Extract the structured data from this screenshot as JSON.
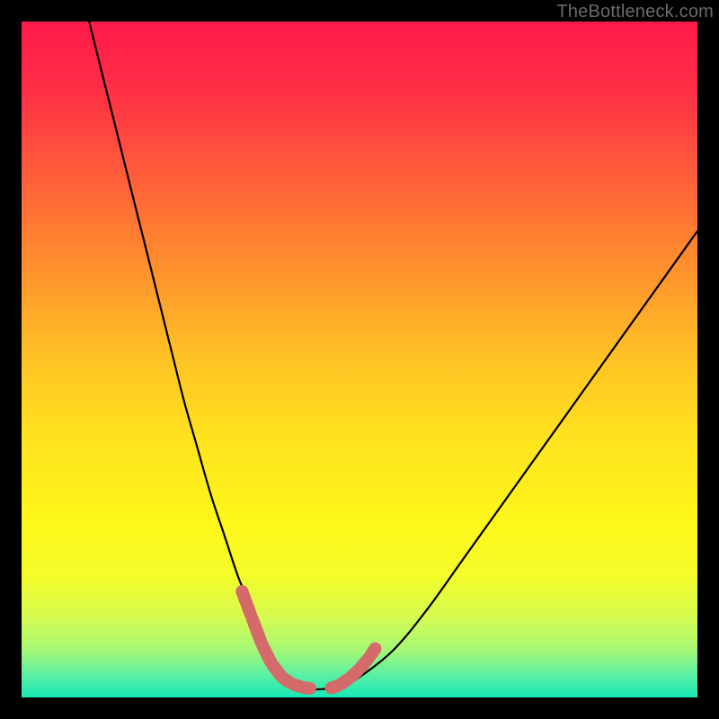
{
  "watermark": {
    "text": "TheBottleneck.com"
  },
  "chart_data": {
    "type": "line",
    "title": "",
    "xlabel": "",
    "ylabel": "",
    "xlim": [
      0,
      100
    ],
    "ylim": [
      0,
      100
    ],
    "grid": false,
    "legend": false,
    "background_gradient": {
      "stops": [
        {
          "t": 0.0,
          "color": "#ff1a4b"
        },
        {
          "t": 0.1,
          "color": "#ff2f46"
        },
        {
          "t": 0.22,
          "color": "#ff5a3a"
        },
        {
          "t": 0.35,
          "color": "#ff8b2e"
        },
        {
          "t": 0.5,
          "color": "#ffc325"
        },
        {
          "t": 0.62,
          "color": "#ffe31e"
        },
        {
          "t": 0.74,
          "color": "#fef71a"
        },
        {
          "t": 0.82,
          "color": "#f4fc2a"
        },
        {
          "t": 0.88,
          "color": "#d6fb4f"
        },
        {
          "t": 0.93,
          "color": "#a6f877"
        },
        {
          "t": 0.965,
          "color": "#5ef0a2"
        },
        {
          "t": 1.0,
          "color": "#17e8b7"
        }
      ]
    },
    "series": [
      {
        "name": "bottleneck-curve",
        "color": "#000000",
        "x": [
          10,
          12,
          14,
          16,
          18,
          20,
          22,
          24,
          26,
          28,
          30,
          32,
          34,
          36,
          37,
          38,
          39,
          40,
          42,
          44,
          46,
          48,
          50,
          55,
          60,
          65,
          70,
          75,
          80,
          85,
          90,
          95,
          100
        ],
        "y": [
          100,
          92,
          84,
          76,
          68,
          60,
          52,
          44,
          37,
          30,
          24,
          18,
          13,
          8,
          5,
          3,
          2,
          1.5,
          1.2,
          1.2,
          1.4,
          2,
          3,
          7,
          13,
          20,
          27,
          34,
          41,
          48,
          55,
          62,
          69
        ]
      }
    ],
    "highlight_segments": [
      {
        "name": "left-dip-marker",
        "color": "#d46a6a",
        "points": [
          {
            "x": 32.5,
            "y": 16
          },
          {
            "x": 34.0,
            "y": 12
          },
          {
            "x": 35.5,
            "y": 8
          },
          {
            "x": 37.0,
            "y": 5
          },
          {
            "x": 38.5,
            "y": 3
          },
          {
            "x": 40.0,
            "y": 2
          },
          {
            "x": 41.5,
            "y": 1.5
          },
          {
            "x": 43.0,
            "y": 1.3
          }
        ]
      },
      {
        "name": "right-dip-marker",
        "color": "#d46a6a",
        "points": [
          {
            "x": 45.5,
            "y": 1.3
          },
          {
            "x": 47.0,
            "y": 1.8
          },
          {
            "x": 48.5,
            "y": 2.8
          },
          {
            "x": 50.0,
            "y": 4.2
          },
          {
            "x": 51.5,
            "y": 6.0
          },
          {
            "x": 52.5,
            "y": 7.5
          }
        ]
      }
    ]
  }
}
